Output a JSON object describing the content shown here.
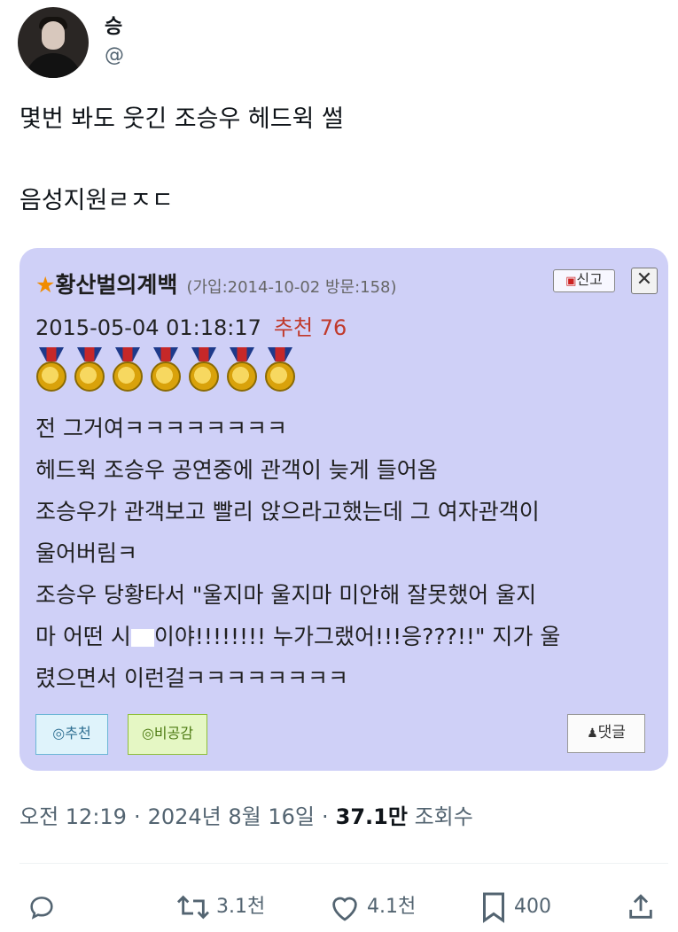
{
  "author": {
    "name": "승",
    "handle": "@"
  },
  "tweet": {
    "line1": "몇번 봐도 웃긴 조승우 헤드윅 썰",
    "line2": "음성지원ㄹㅈㄷ"
  },
  "card": {
    "star": "★",
    "nickname": "황산벌의계백",
    "join_info": "(가입:2014-10-02 방문:158)",
    "report_label": "신고",
    "close_label": "✕",
    "datetime": "2015-05-04 01:18:17",
    "recommend_label": "추천 76",
    "medal_count": 7,
    "body_lines": [
      "전 그거여ㅋㅋㅋㅋㅋㅋㅋㅋ",
      "헤드윅 조승우 공연중에 관객이 늦게 들어옴",
      "조승우가 관객보고 빨리 앉으라고했는데 그 여자관객이",
      "울어버림ㅋ",
      "조승우 당황타서 \"울지마 울지마 미안해 잘못했어 울지"
    ],
    "body_line6_a": "마 어떤 시",
    "body_line6_b": "이야!!!!!!!! 누가그랬어!!!응???!!\" 지가 울",
    "body_line7": "렸으면서 이런걸ㅋㅋㅋㅋㅋㅋㅋㅋ",
    "btn_recommend": "◎추천",
    "btn_disagree": "◎비공감",
    "btn_comment": "댓글"
  },
  "meta": {
    "time": "오전 12:19",
    "date": "2024년 8월 16일",
    "views_num": "37.1만",
    "views_label": "조회수"
  },
  "actions": {
    "retweets": "3.1천",
    "likes": "4.1천",
    "bookmarks": "400"
  }
}
